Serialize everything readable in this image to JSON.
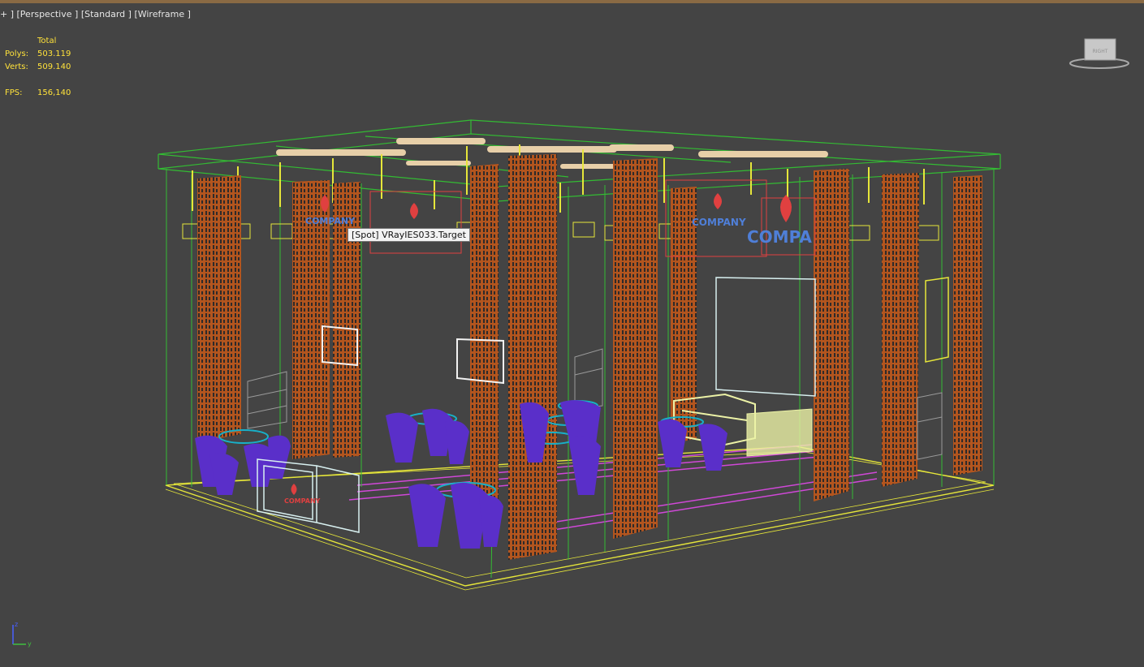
{
  "viewport": {
    "label_parts": [
      "+ ]",
      "[Perspective ]",
      "[Standard ]",
      "[Wireframe ]"
    ]
  },
  "stats": {
    "header": "Total",
    "polys_label": "Polys:",
    "polys_value": "503.119",
    "verts_label": "Verts:",
    "verts_value": "509.140",
    "fps_label": "FPS:",
    "fps_value": "156,140"
  },
  "tooltip": {
    "text": "[Spot] VRayIES033.Target"
  },
  "scene": {
    "signs": [
      {
        "text": "COMPANY"
      },
      {
        "text": "COMPANY"
      },
      {
        "text": "COMPA"
      },
      {
        "text": "COMPANY"
      }
    ]
  },
  "viewcube": {
    "face_label": "RIGHT"
  },
  "axis": {
    "z_label": "z",
    "y_label": "y"
  },
  "colors": {
    "background": "#444444",
    "stats_text": "#ffe23a",
    "frame_green": "#33bb33",
    "floor_yellow": "#e6e63a",
    "panel_orange": "#b3551e",
    "furniture_purple": "#5a2fc9",
    "sofa_lime": "#ecf2a6",
    "carpet_magenta": "#d048d8",
    "sign_blue": "#4f7fd8",
    "sign_red": "#e04040"
  }
}
